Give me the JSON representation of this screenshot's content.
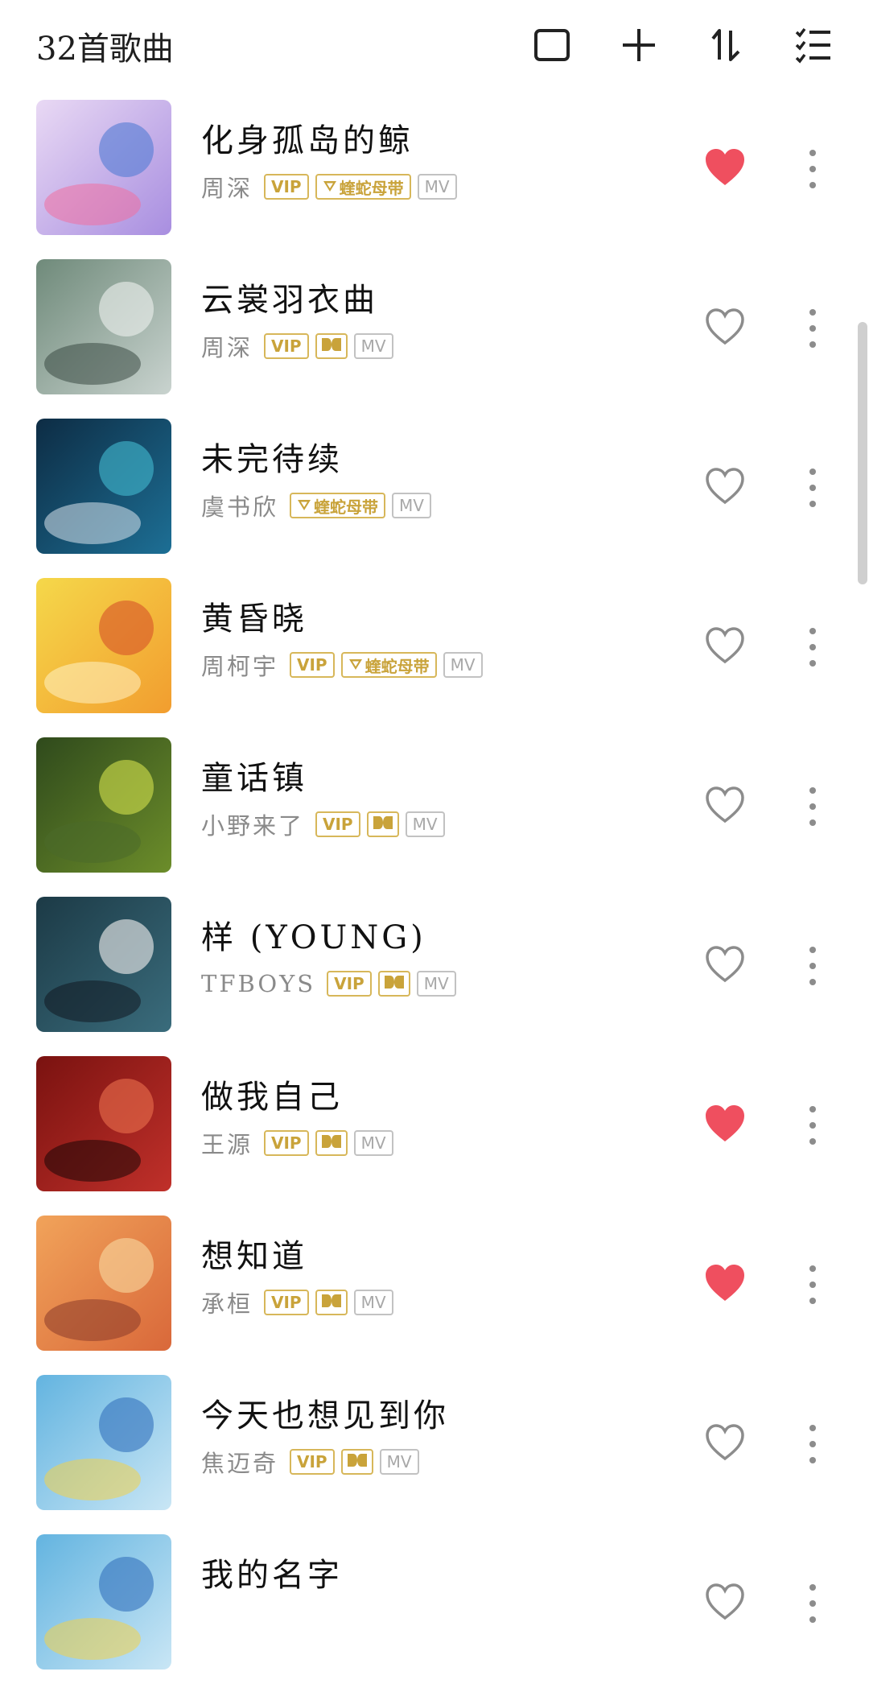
{
  "header": {
    "song_count": "32首歌曲",
    "icons": [
      "select-square-icon",
      "add-icon",
      "sort-icon",
      "list-menu-icon"
    ]
  },
  "badges": {
    "vip": "VIP",
    "snake": "蝰蛇母带",
    "mv": "MV"
  },
  "songs": [
    {
      "title": "化身孤岛的鲸",
      "artist": "周深",
      "vip": true,
      "quality": "snake",
      "liked": true
    },
    {
      "title": "云裳羽衣曲",
      "artist": "周深",
      "vip": true,
      "quality": "dolby",
      "liked": false
    },
    {
      "title": "未完待续",
      "artist": "虞书欣",
      "vip": false,
      "quality": "snake",
      "liked": false
    },
    {
      "title": "黄昏晓",
      "artist": "周柯宇",
      "vip": true,
      "quality": "snake",
      "liked": false
    },
    {
      "title": "童话镇",
      "artist": "小野来了",
      "vip": true,
      "quality": "dolby",
      "liked": false
    },
    {
      "title": "样 (YOUNG)",
      "artist": "TFBOYS",
      "vip": true,
      "quality": "dolby",
      "liked": false
    },
    {
      "title": "做我自己",
      "artist": "王源",
      "vip": true,
      "quality": "dolby",
      "liked": true
    },
    {
      "title": "想知道",
      "artist": "承桓",
      "vip": true,
      "quality": "dolby",
      "liked": true
    },
    {
      "title": "今天也想见到你",
      "artist": "焦迈奇",
      "vip": true,
      "quality": "dolby",
      "liked": false
    },
    {
      "title": "我的名字",
      "artist": "",
      "vip": false,
      "quality": "",
      "liked": false
    }
  ],
  "colors": {
    "liked_heart": "#ef4f5f",
    "heart_outline": "#8c8c8c",
    "badge_gold": "#d7b75a",
    "mv_gray": "#c2c2c2"
  }
}
